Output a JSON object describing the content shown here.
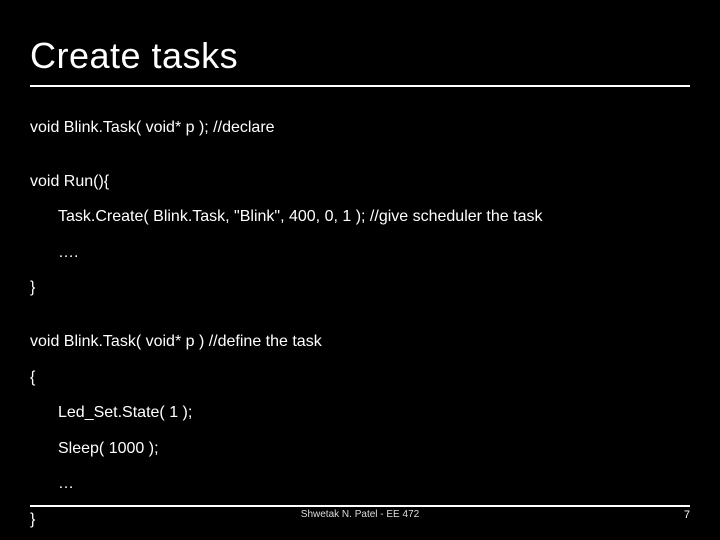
{
  "title": "Create tasks",
  "lines": {
    "l1": "void Blink.Task( void* p ); //declare",
    "l2": "void Run(){",
    "l3": "Task.Create( Blink.Task, \"Blink\", 400, 0, 1 ); //give scheduler the task",
    "l4": "….",
    "l5": "}",
    "l6": "void Blink.Task( void* p ) //define the task",
    "l7": "{",
    "l8": "Led_Set.State( 1 );",
    "l9": "Sleep( 1000 );",
    "l10": "…",
    "l11": "}"
  },
  "footer": {
    "text": "Shwetak N. Patel - EE 472",
    "page": "7"
  }
}
